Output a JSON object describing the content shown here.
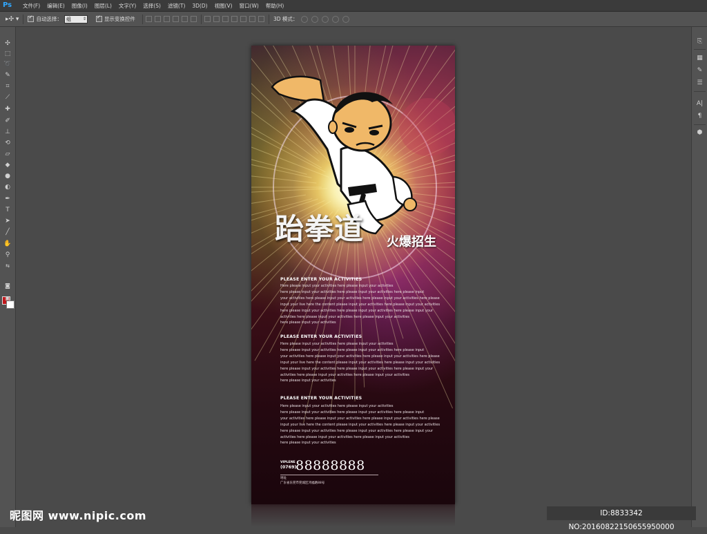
{
  "app": {
    "logo": "Ps"
  },
  "menu": [
    "文件(F)",
    "编辑(E)",
    "图像(I)",
    "图层(L)",
    "文字(Y)",
    "选择(S)",
    "滤镜(T)",
    "3D(D)",
    "视图(V)",
    "窗口(W)",
    "帮助(H)"
  ],
  "options": {
    "auto_select_label": "自动选择：",
    "auto_select_value": "组",
    "show_transform_label": "显示变换控件",
    "mode_3d_label": "3D 模式："
  },
  "colors": {
    "foreground": "#c0171b",
    "background": "#ffffff",
    "ps_blue": "#31a8ff"
  },
  "tools": [
    "move-icon",
    "marquee-icon",
    "lasso-icon",
    "quick-select-icon",
    "crop-icon",
    "eyedropper-icon",
    "healing-icon",
    "brush-icon",
    "stamp-icon",
    "history-brush-icon",
    "eraser-icon",
    "paint-bucket-icon",
    "blur-icon",
    "dodge-icon",
    "pen-icon",
    "type-icon",
    "path-select-icon",
    "shape-icon",
    "hand-icon",
    "zoom-icon"
  ],
  "right_panels": [
    "history-icon",
    "adjustments-icon",
    "brushes-icon",
    "sliders-icon",
    "character-icon",
    "paragraph-icon",
    "3d-icon"
  ],
  "poster": {
    "title": "跆拳道",
    "subtitle": "火爆招生",
    "sections": [
      {
        "heading": "PLEASE ENTER YOUR ACTIVITIES",
        "lines": [
          "Here please input your activities here please input your activities",
          "here please input your activities here please input your activities here please input",
          "your activities here please input your activities here please input your activities here please",
          "input your live here the content please input your activities here please input your activities",
          "here please input your activities here please input your activities here please input your",
          " activities here please input your activities here please input your activities",
          "here please input your activities"
        ]
      },
      {
        "heading": "PLEASE ENTER YOUR ACTIVITIES",
        "lines": [
          "Here please input your activities here please input your activities",
          "here please input your activities here please input your activities here please input",
          "your activities here please input your activities here please input your activities here please",
          "input your live here the content please input your activities here please input your activities",
          "here please input your activities here please input your activities here please input your",
          " activities here please input your activities here please input your activities",
          "here please input your activities"
        ]
      },
      {
        "heading": "PLEASE ENTER YOUR ACTIVITIES",
        "lines": [
          "Here please input your activities here please input your activities",
          "here please input your activities here please input your activities here please input",
          "your activities here please input your activities here please input your activities here please",
          "input your live here the content please input your activities here please input your activities",
          "here please input your activities here please input your activities here please input your",
          " activities here please input your activities here please input your activities",
          "here please input your activities"
        ]
      }
    ],
    "vip_label": "VIPLENE",
    "area_code": "(0769)",
    "phone": "88888888",
    "address_label": "地址",
    "address": "广东省东莞市莞城区鸿福路88号"
  },
  "watermark": {
    "logo": "昵图网 www.nipic.com",
    "id": "ID:8833342 NO:20160822150655950000"
  }
}
